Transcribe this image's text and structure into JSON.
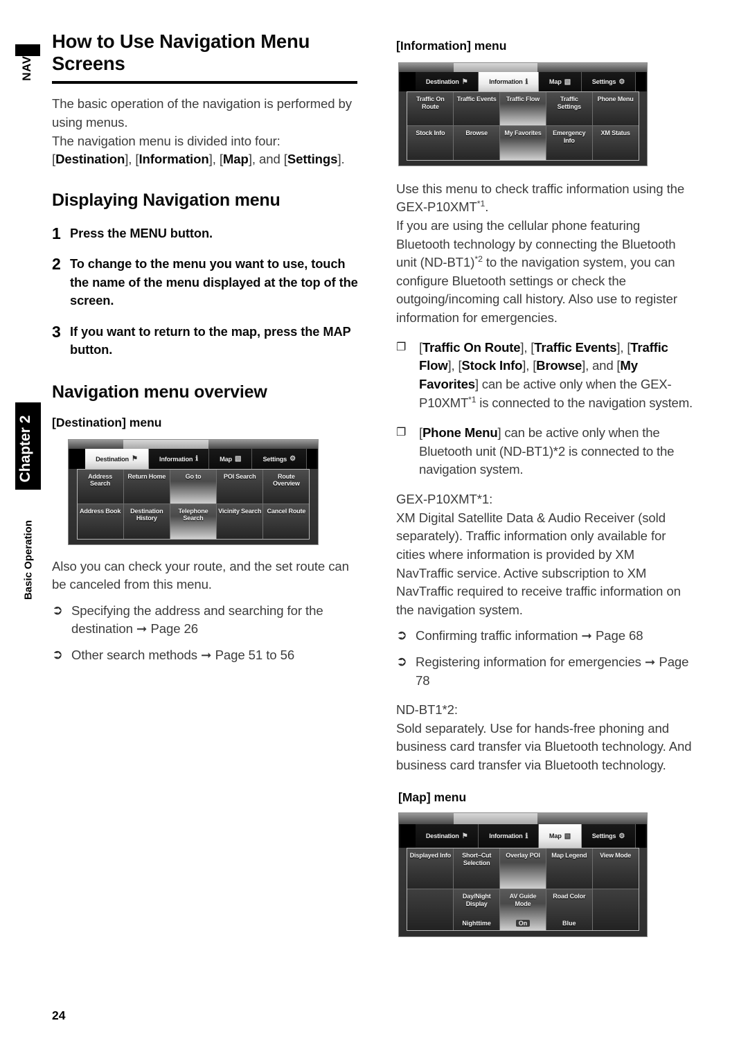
{
  "sidebar": {
    "navi_label": "NAVI",
    "chapter_label": "Chapter 2",
    "section_label": "Basic Operation"
  },
  "page_number": "24",
  "left": {
    "h1": "How to Use Navigation Menu Screens",
    "intro_p1": "The basic operation of the navigation is performed by using menus.",
    "intro_p2_pre": "The navigation menu is divided into four: [",
    "intro_b1": "Destination",
    "intro_mid1": "], [",
    "intro_b2": "Information",
    "intro_mid2": "], [",
    "intro_b3": "Map",
    "intro_mid3": "], and [",
    "intro_b4": "Settings",
    "intro_end": "].",
    "h2_displaying": "Displaying Navigation menu",
    "steps": [
      {
        "num": "1",
        "text": "Press the MENU button."
      },
      {
        "num": "2",
        "text": "To change to the menu you want to use, touch the name of the menu displayed at the top of the screen."
      },
      {
        "num": "3",
        "text": "If you want to return to the map, press the MAP button."
      }
    ],
    "h2_overview": "Navigation menu overview",
    "h3_destination": "[Destination] menu",
    "after_dest": "Also you can check your route, and the set route can be canceled from this menu.",
    "refs": [
      {
        "icon": "➲",
        "text": "Specifying the address and searching for the destination ➞ Page 26"
      },
      {
        "icon": "➲",
        "text": "Other search methods ➞ Page 51 to 56"
      }
    ]
  },
  "right": {
    "h3_information": "[Information] menu",
    "p1_a": "Use this menu to check traffic information using the GEX-P10XMT",
    "p1_sup": "*1",
    "p1_b": ".",
    "p2_a": "If you are using the cellular phone featuring Bluetooth technology by connecting the Bluetooth unit (ND-BT1)",
    "p2_sup": "*2",
    "p2_b": " to the navigation system, you can configure Bluetooth settings or check the outgoing/incoming call history. Also use to register information for emergencies.",
    "notes": [
      {
        "icon": "❐",
        "b1": "Traffic On Route",
        "t1": "], [",
        "b2": "Traffic Events",
        "t2": "], [",
        "b3": "Traffic Flow",
        "t3": "], [",
        "b4": "Stock Info",
        "t4": "], [",
        "b5": "Browse",
        "t5": "], and [",
        "b6": "My Favorites",
        "t6": "] can be active only when the GEX-P10XMT",
        "sup": "*1",
        "t7": " is connected to the navigation system."
      },
      {
        "icon": "❐",
        "b1": "Phone Menu",
        "t1": "] can be active only when the Bluetooth unit (ND-BT1)*2 is connected to the navigation system."
      }
    ],
    "gex_label": "GEX-P10XMT*1:",
    "gex_text": "XM Digital Satellite Data & Audio Receiver (sold separately). Traffic information only available for cities where information is provided by XM NavTraffic service. Active subscription to XM NavTraffic required to receive traffic information on the navigation system.",
    "refs": [
      {
        "icon": "➲",
        "text": "Confirming traffic information ➞ Page 68"
      },
      {
        "icon": "➲",
        "text": "Registering information for emergencies ➞ Page 78"
      }
    ],
    "nd_label": "ND-BT1*2:",
    "nd_text": "Sold separately. Use for hands-free phoning and business card transfer via Bluetooth technology. And business card transfer via Bluetooth technology.",
    "h3_map": "[Map] menu"
  },
  "device_tabs": {
    "destination": "Destination",
    "information": "Information",
    "map": "Map",
    "settings": "Settings",
    "icons": {
      "destination": "checkered-flag-icon",
      "information": "info-i-icon",
      "map": "folded-map-icon",
      "settings": "gear-icon"
    }
  },
  "destination_screen": {
    "active_tab": "Destination",
    "rows": [
      [
        {
          "label": "Address Search",
          "lit": false
        },
        {
          "label": "Return Home",
          "lit": false
        },
        {
          "label": "Go to",
          "lit": true
        },
        {
          "label": "POI Search",
          "lit": false
        },
        {
          "label": "Route Overview",
          "lit": false
        }
      ],
      [
        {
          "label": "Address Book",
          "lit": false
        },
        {
          "label": "Destination History",
          "lit": false
        },
        {
          "label": "Telephone Search",
          "lit": true
        },
        {
          "label": "Vicinity Search",
          "lit": false
        },
        {
          "label": "Cancel Route",
          "lit": false
        }
      ]
    ]
  },
  "information_screen": {
    "active_tab": "Information",
    "rows": [
      [
        {
          "label": "Traffic On Route",
          "lit": false
        },
        {
          "label": "Traffic Events",
          "lit": false
        },
        {
          "label": "Traffic Flow",
          "lit": true
        },
        {
          "label": "Traffic Settings",
          "lit": false
        },
        {
          "label": "Phone Menu",
          "lit": false
        }
      ],
      [
        {
          "label": "Stock Info",
          "lit": false
        },
        {
          "label": "Browse",
          "lit": false
        },
        {
          "label": "My Favorites",
          "lit": true
        },
        {
          "label": "Emergency Info",
          "lit": false
        },
        {
          "label": "XM Status",
          "lit": false
        }
      ]
    ]
  },
  "map_screen": {
    "active_tab": "Map",
    "rows": [
      [
        {
          "label": "Displayed Info",
          "lit": false
        },
        {
          "label": "Short–Cut Selection",
          "lit": false
        },
        {
          "label": "Overlay POI",
          "lit": true
        },
        {
          "label": "Map Legend",
          "lit": false
        },
        {
          "label": "View Mode",
          "lit": false
        }
      ],
      [
        {
          "label": "",
          "lit": false,
          "empty": true
        },
        {
          "label": "Day/Night Display",
          "value": "Nighttime",
          "lit": false
        },
        {
          "label": "AV Guide Mode",
          "value": "On",
          "lit": true
        },
        {
          "label": "Road Color",
          "value": "Blue",
          "lit": false
        },
        {
          "label": "",
          "lit": false,
          "empty": true
        }
      ]
    ]
  }
}
